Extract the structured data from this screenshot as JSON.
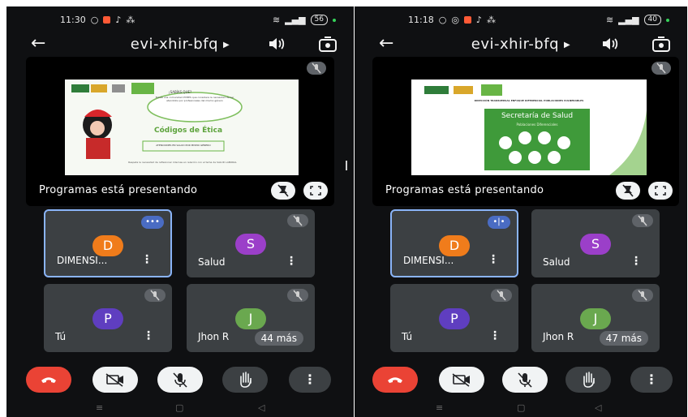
{
  "screens": [
    {
      "status": {
        "time": "11:30",
        "battery": "56"
      },
      "meeting_code": "evi-xhir-bfq",
      "presenting_label": "Programas está presentando",
      "participants": [
        {
          "initial": "D",
          "name": "DIMENSI...",
          "color": "#f07c1b",
          "state": "speaking"
        },
        {
          "initial": "S",
          "name": "Salud",
          "color": "#9b3fc9",
          "state": "muted"
        },
        {
          "initial": "P",
          "name": "Tú",
          "color": "#5f3ec0",
          "state": "muted"
        },
        {
          "initial": "J",
          "name": "Jhon R",
          "color": "#6aa84f",
          "state": "muted"
        }
      ],
      "overflow_label": "44 más"
    },
    {
      "status": {
        "time": "11:18",
        "battery": "40"
      },
      "meeting_code": "evi-xhir-bfq",
      "presenting_label": "Programas está presentando",
      "participants": [
        {
          "initial": "D",
          "name": "DIMENSI...",
          "color": "#f07c1b",
          "state": "speaking"
        },
        {
          "initial": "S",
          "name": "Salud",
          "color": "#9b3fc9",
          "state": "muted"
        },
        {
          "initial": "P",
          "name": "Tú",
          "color": "#5f3ec0",
          "state": "muted"
        },
        {
          "initial": "J",
          "name": "Jhon R",
          "color": "#6aa84f",
          "state": "muted"
        }
      ],
      "overflow_label": "47 más"
    }
  ],
  "slides": {
    "left": {
      "heading": "Códigos de Ética",
      "cloud_title": "¡SABÍAS QUE?",
      "cloud_text": "Existe una comunidad PYMES que considera la necesidad de ser atendidos por profesionales del mismo género",
      "banner": "ATENCIONES EN SALUD POR MISMO GÉNERO",
      "footer": "Respeta la necesidad de reflexionar internas en relación con el tema de SALUD LABORAL"
    },
    "right": {
      "header": "DIRECCIÓN TRANSVERSAL ENFOQUE DIFERENCIAL POBLACIONES VULNERABLES",
      "title": "Secretaría de Salud",
      "subtitle": "Poblaciones Diferenciales"
    }
  },
  "colors": {
    "end_call": "#ea4335",
    "control_light": "#f1f3f4",
    "control_dark": "#3c4043",
    "accent_active": "#8ab4f8"
  },
  "icons": [
    "back-arrow-icon",
    "chevron-right-icon",
    "speaker-icon",
    "switch-camera-icon",
    "mic-off-icon",
    "pin-off-icon",
    "fullscreen-icon",
    "audio-wave-icon",
    "more-vert-icon",
    "hang-up-icon",
    "camera-off-icon",
    "hand-raise-icon"
  ]
}
